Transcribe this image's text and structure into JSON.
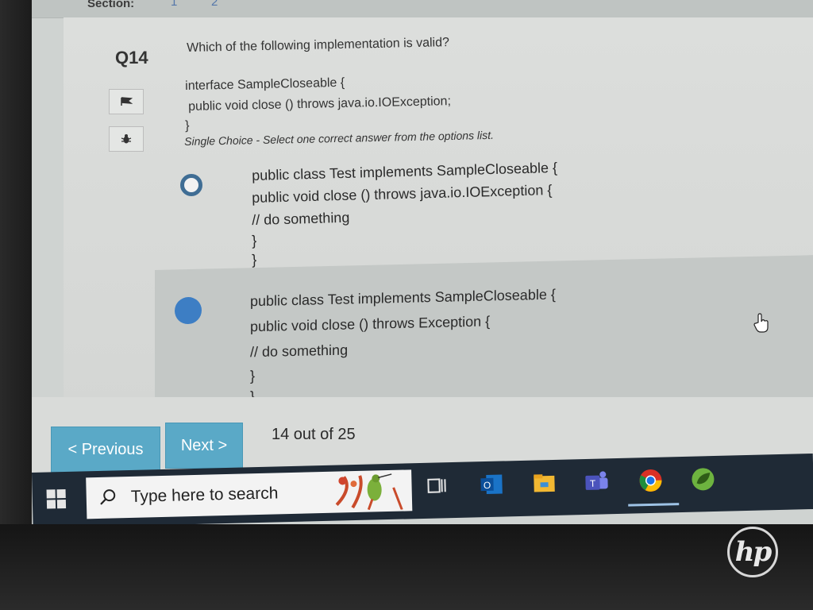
{
  "header": {
    "section_label": "Section:",
    "sections": [
      "1",
      "2"
    ]
  },
  "question": {
    "number": "Q14",
    "text": "Which of the following implementation is valid?",
    "code": [
      "interface SampleCloseable {",
      "public void close () throws java.io.IOException;",
      "}"
    ],
    "instruction": "Single Choice - Select one correct answer from the options list.",
    "flag_icon": "flag-icon",
    "bug_icon": "bug-icon"
  },
  "options": [
    {
      "selected": false,
      "lines": [
        "public class Test implements SampleCloseable {",
        "public void close () throws java.io.IOException {",
        "// do something",
        "}",
        "}"
      ]
    },
    {
      "selected": true,
      "lines": [
        "public class Test implements SampleCloseable {",
        "public void close () throws Exception {",
        "// do something",
        "}",
        "}"
      ]
    }
  ],
  "nav": {
    "previous_label": "< Previous",
    "next_label": "Next >",
    "progress": "14 out of 25"
  },
  "taskbar": {
    "search_placeholder": "Type here to search",
    "apps": [
      "task-view-icon",
      "outlook-icon",
      "file-explorer-icon",
      "teams-icon",
      "chrome-icon",
      "spring-icon"
    ]
  },
  "brand": {
    "logo": "hp"
  },
  "colors": {
    "accent": "#5aa9c7",
    "radio_selected": "#3d7ec4",
    "radio_border": "#3f6d94",
    "taskbar": "#1f2a36"
  }
}
